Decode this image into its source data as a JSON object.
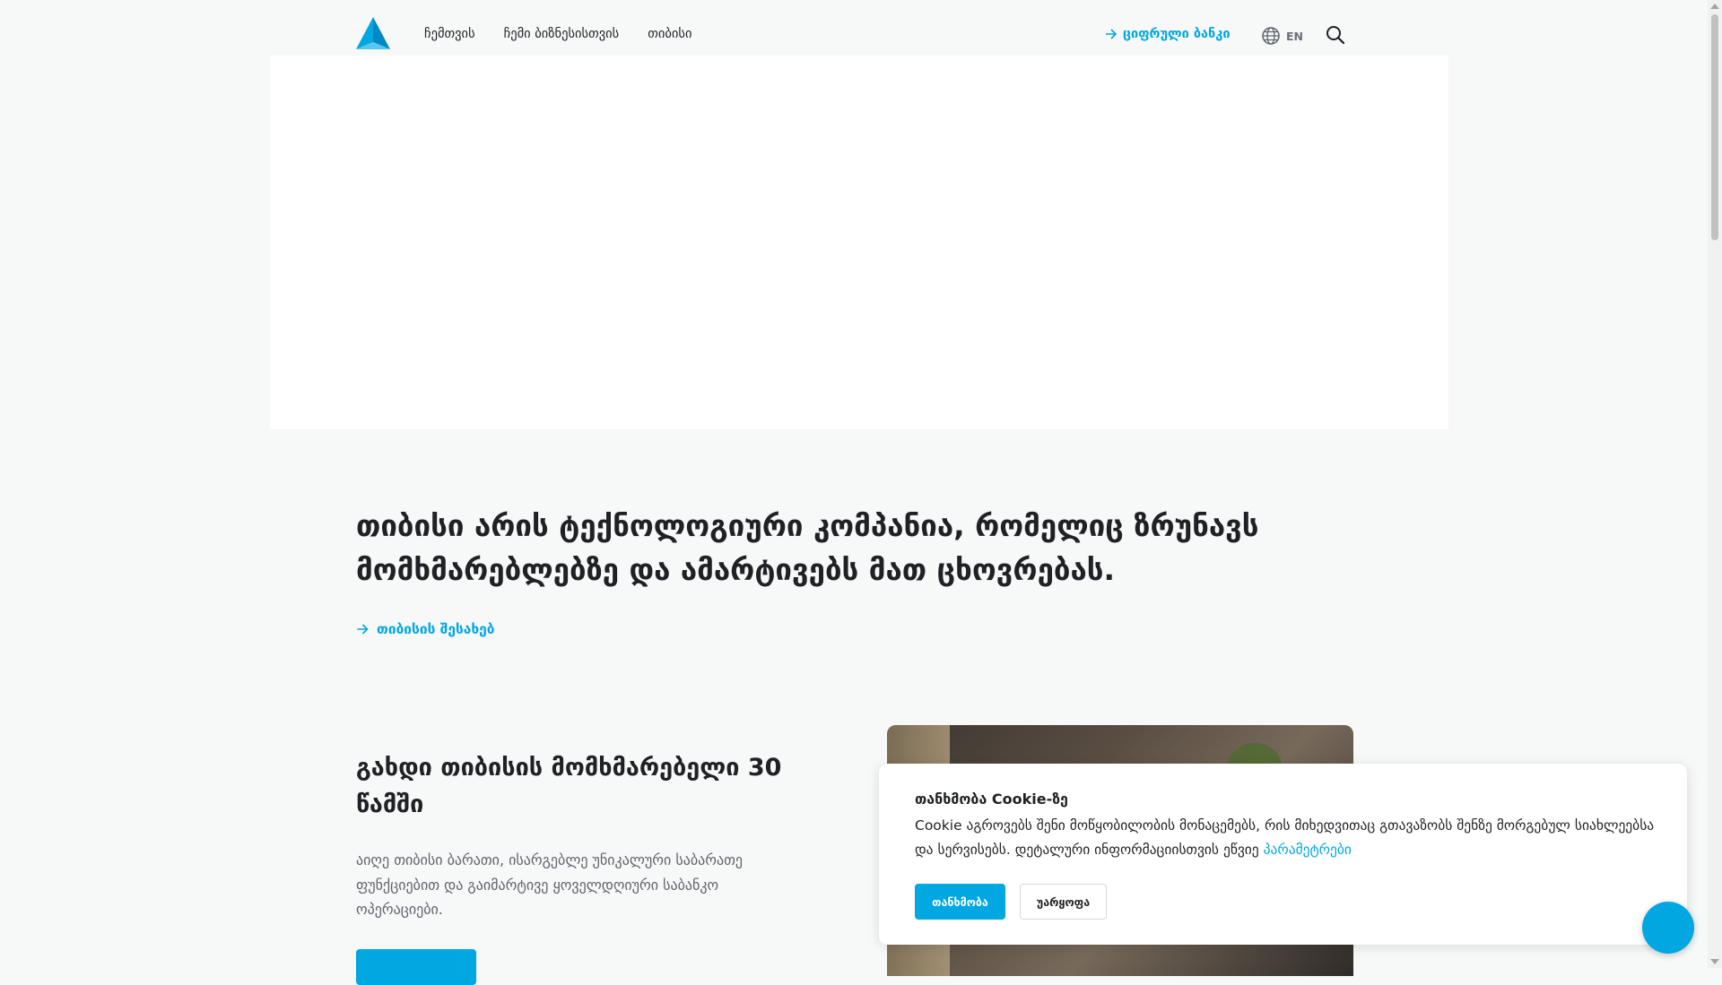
{
  "colors": {
    "accent": "#00a7e1",
    "text": "#1f2124",
    "muted": "#5f646b",
    "background": "#f7f8f8"
  },
  "header": {
    "logo_icon": "tbc-triangle-logo",
    "nav": [
      {
        "label": "ჩემთვის"
      },
      {
        "label": "ჩემი ბიზნესისთვის"
      },
      {
        "label": "თიბისი"
      }
    ],
    "digital_bank": "ციფრული ბანკი",
    "language": "EN",
    "search_icon": "search-icon"
  },
  "hero": {
    "headline": "თიბისი არის ტექნოლოგიური კომპანია, რომელიც ზრუნავს მომხმარებლებზე და ამარტივებს მათ ცხოვრებას.",
    "about_link": "თიბისის შესახებ"
  },
  "section": {
    "title": "გახდი თიბისის მომხმარებელი 30 წამში",
    "text": "აიღე თიბისი ბარათი, ისარგებლე უნიკალური საბარათე ფუნქციებით და გაიმარტივე ყოველდღიური საბანკო ოპერაციები."
  },
  "cookie": {
    "title": "თანხმობა Cookie-ზე",
    "text": "Cookie აგროვებს შენი მოწყობილობის მონაცემებს, რის მიხედვითაც გთავაზობს შენზე მორგებულ სიახლეებსა და სერვისებს. დეტალური ინფორმაციისთვის ეწვიე",
    "link": "პარამეტრები",
    "accept": "თანხმობა",
    "reject": "უარყოფა"
  }
}
